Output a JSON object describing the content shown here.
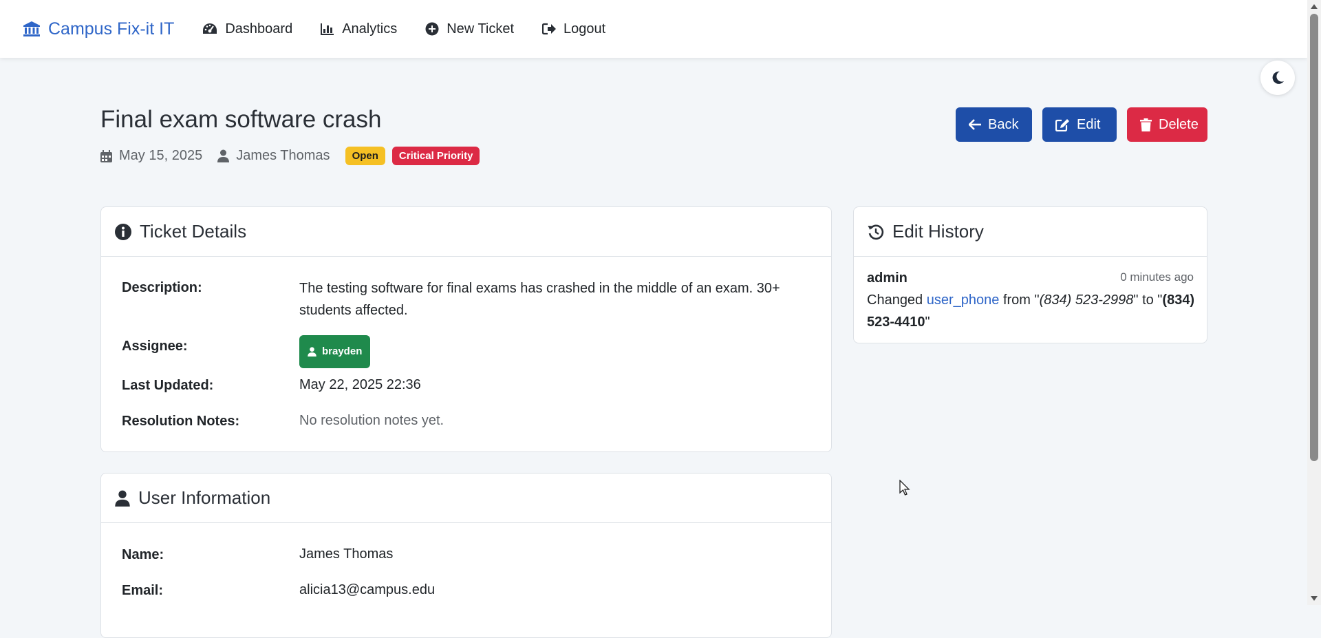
{
  "nav": {
    "brand": "Campus Fix-it IT",
    "links": [
      {
        "label": "Dashboard",
        "icon": "gauge-icon"
      },
      {
        "label": "Analytics",
        "icon": "bar-chart-icon"
      },
      {
        "label": "New Ticket",
        "icon": "plus-circle-icon"
      },
      {
        "label": "Logout",
        "icon": "sign-out-icon"
      }
    ]
  },
  "theme_toggle": {
    "icon": "moon-icon"
  },
  "ticket": {
    "title": "Final exam software crash",
    "date": "May 15, 2025",
    "reporter": "James Thomas",
    "status": "Open",
    "priority": "Critical Priority"
  },
  "actions": {
    "back": "Back",
    "edit": "Edit",
    "delete": "Delete"
  },
  "details": {
    "header": "Ticket Details",
    "description_label": "Description:",
    "description": "The testing software for final exams has crashed in the middle of an exam. 30+ students affected.",
    "assignee_label": "Assignee:",
    "assignee": "brayden",
    "last_updated_label": "Last Updated:",
    "last_updated": "May 22, 2025 22:36",
    "resolution_label": "Resolution Notes:",
    "resolution": "No resolution notes yet."
  },
  "history": {
    "header": "Edit History",
    "user": "admin",
    "time": "0 minutes ago",
    "changed": "Changed",
    "field": "user_phone",
    "from_word": "from",
    "old_value": "(834) 523-2998",
    "to_word": "to",
    "new_value": "(834) 523-4410"
  },
  "user_info": {
    "header": "User Information",
    "name_label": "Name:",
    "name": "James Thomas",
    "email_label": "Email:",
    "email": "alicia13@campus.edu"
  },
  "colors": {
    "brand": "#2f66c8",
    "primary_button": "#1e4ea8",
    "danger": "#dc2a45",
    "warning": "#f5c024",
    "success": "#1f8a4c",
    "background": "#f3f6f9"
  }
}
